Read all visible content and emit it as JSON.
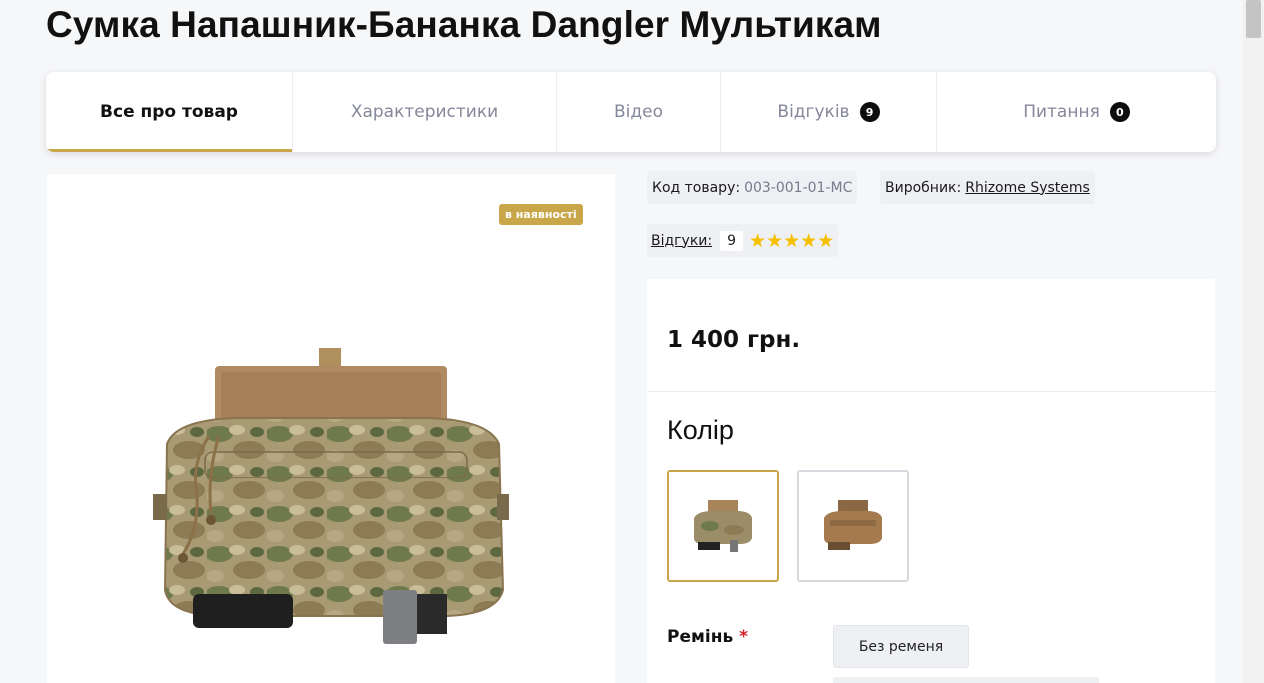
{
  "product": {
    "title": "Сумка Напашник-Бананка Dangler Мультикам",
    "stock_badge": "в наявності",
    "code_label": "Код товару:",
    "code_value": "003-001-01-MC",
    "maker_label": "Виробник:",
    "maker_value": "Rhizome Systems",
    "reviews_label": "Відгуки:",
    "reviews_count": "9",
    "rating_stars": 5,
    "price": "1 400 грн.",
    "color_label": "Колір",
    "strap_label": "Ремінь",
    "strap_required_mark": "*",
    "strap_option": "Без ременя"
  },
  "tabs": [
    {
      "label": "Все про товар",
      "count": null,
      "active": true
    },
    {
      "label": "Характеристики",
      "count": null,
      "active": false
    },
    {
      "label": "Відео",
      "count": null,
      "active": false
    },
    {
      "label": "Відгуків",
      "count": "9",
      "active": false
    },
    {
      "label": "Питання",
      "count": "0",
      "active": false
    }
  ],
  "colors": {
    "accent": "#c9a64a",
    "star": "#f5c000",
    "required": "#d21f2b"
  },
  "icons": {
    "star": "star-icon"
  }
}
